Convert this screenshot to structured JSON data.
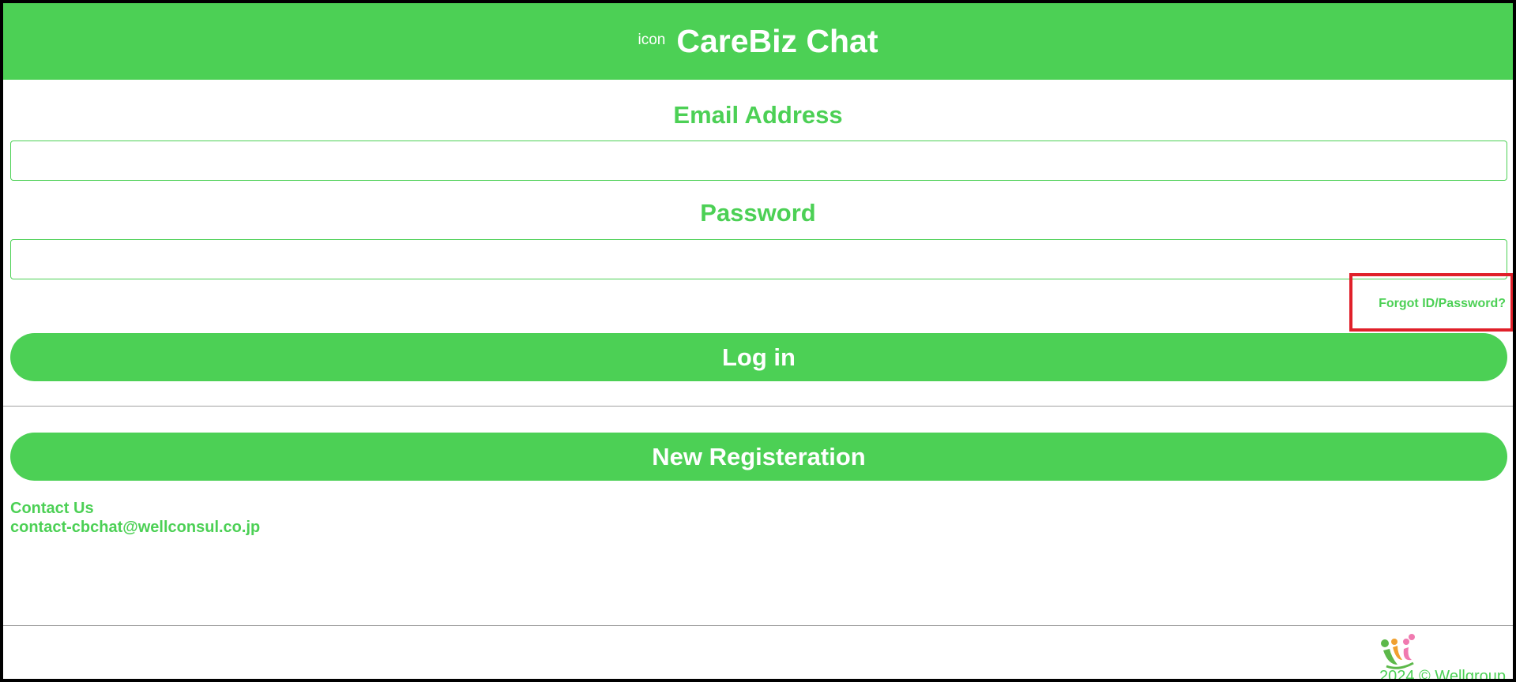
{
  "header": {
    "icon_text": "icon",
    "title": "CareBiz Chat"
  },
  "login_form": {
    "email_label": "Email Address",
    "email_value": "",
    "password_label": "Password",
    "password_value": "",
    "forgot_link": "Forgot ID/Password?",
    "login_button": "Log in"
  },
  "registration": {
    "button_label": "New Registeration"
  },
  "contact": {
    "heading": "Contact Us",
    "email": "contact-cbchat@wellconsul.co.jp"
  },
  "footer": {
    "copyright": "2024 © Wellgroup",
    "logo_icon": "wellgroup-logo-icon"
  },
  "colors": {
    "brand_green": "#4cd055",
    "highlight_red": "#e0202a",
    "divider_gray": "#a0a0a0"
  }
}
